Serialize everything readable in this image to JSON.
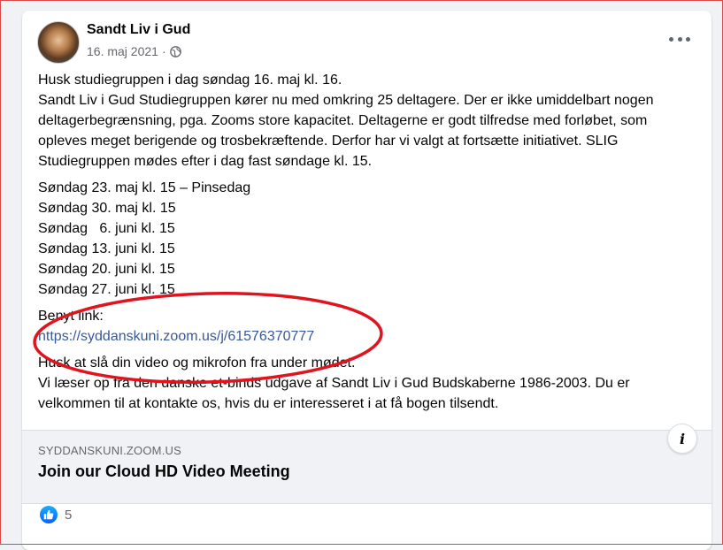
{
  "post": {
    "author": "Sandt Liv i Gud",
    "date": "16. maj 2021",
    "separator": "·",
    "paragraphs": [
      "Husk studiegruppen i dag søndag 16. maj kl. 16.\nSandt Liv i Gud Studiegruppen kører nu med omkring 25 deltagere. Der er ikke umiddelbart nogen deltagerbegrænsning, pga. Zooms store kapacitet. Deltagerne er godt tilfredse med forløbet, som opleves meget berigende og trosbekræftende. Derfor har vi valgt at fortsætte initiativet. SLIG Studiegruppen mødes efter i dag fast søndage kl. 15."
    ],
    "schedule": [
      "Søndag 23. maj kl. 15 – Pinsedag",
      "Søndag 30. maj kl. 15",
      "Søndag   6. juni kl. 15",
      "Søndag 13. juni kl. 15",
      "Søndag 20. juni kl. 15",
      "Søndag 27. juni kl. 15"
    ],
    "link_label": "Benyt link:",
    "link_url": "https://syddanskuni.zoom.us/j/61576370777",
    "closing_line1": "Husk at slå din video og mikrofon fra under mødet.",
    "closing_line2": "Vi læser op fra den danske et-binds udgave af Sandt Liv i Gud Budskaberne 1986-2003. Du er velkommen til at kontakte os, hvis du er interesseret i at få bogen tilsendt."
  },
  "preview": {
    "domain": "SYDDANSKUNI.ZOOM.US",
    "title": "Join our Cloud HD Video Meeting",
    "info_icon": "i"
  },
  "reactions": {
    "count": "5",
    "icon": "like-icon",
    "color": "#1877f2"
  },
  "annotation_color": "#e0141e"
}
